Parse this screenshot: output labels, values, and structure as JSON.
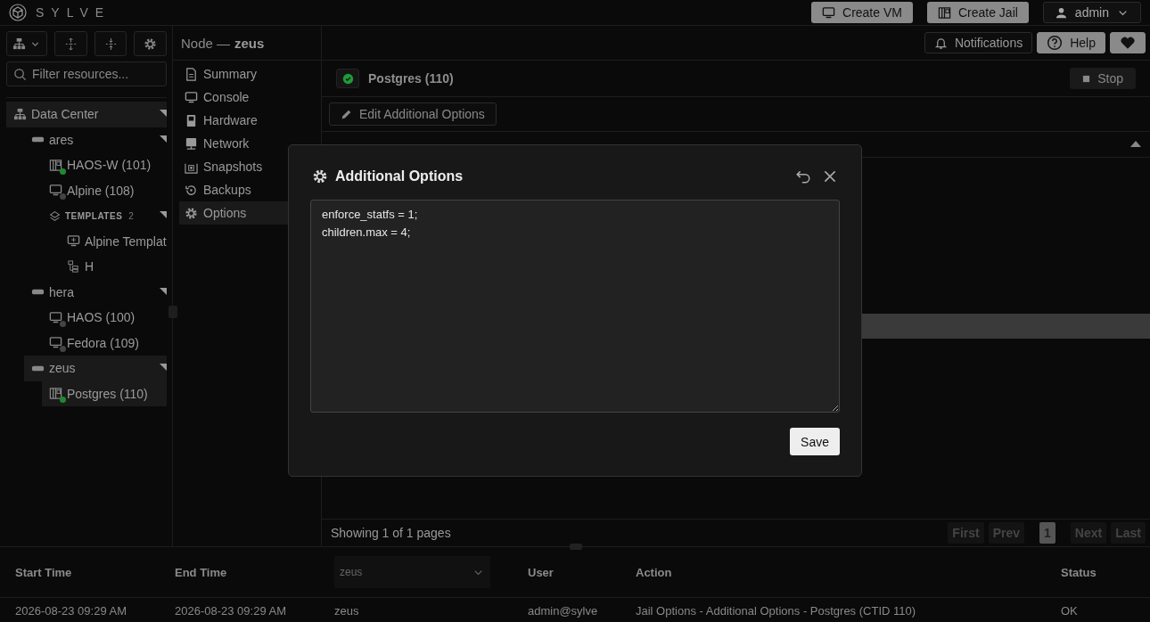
{
  "header": {
    "brand": "SYLVE",
    "buttons": [
      {
        "label": "Create VM",
        "kind": "vm"
      },
      {
        "label": "Create Jail",
        "kind": "jail"
      }
    ],
    "user": "admin"
  },
  "sidebar": {
    "filter": {
      "placeholder": "Filter resources..."
    },
    "tree": [
      {
        "label": "Data Center",
        "kind": "datacenter",
        "expanded": true,
        "children": [
          {
            "label": "ares",
            "kind": "node",
            "expanded": true,
            "children": [
              {
                "label": "HAOS-W (101)",
                "kind": "jail",
                "running": true,
                "selected": false
              },
              {
                "label": "Alpine (108)",
                "kind": "vm",
                "running": false,
                "selected": false
              },
              {
                "label": "TEMPLATES",
                "count": "2",
                "kind": "group",
                "expanded": true,
                "children": [
                  {
                    "label": "Alpine Templat",
                    "kind": "template"
                  },
                  {
                    "label": "H",
                    "kind": "jailtemplate"
                  }
                ]
              }
            ]
          },
          {
            "label": "hera",
            "kind": "node",
            "expanded": true,
            "children": [
              {
                "label": "HAOS (100)",
                "kind": "vm",
                "running": false,
                "selected": false
              },
              {
                "label": "Fedora (109)",
                "kind": "vm",
                "running": false,
                "selected": false
              }
            ]
          },
          {
            "label": "zeus",
            "kind": "node",
            "expanded": true,
            "children": [
              {
                "label": "Postgres (110)",
                "kind": "jail",
                "running": true,
                "selected": true
              }
            ]
          }
        ]
      }
    ]
  },
  "node_title": {
    "label": "Node —",
    "name": "zeus"
  },
  "top_actions": [
    {
      "label": "Notifications",
      "kind": "bell"
    },
    {
      "label": "Help",
      "kind": "help"
    },
    {
      "kind": "heart"
    }
  ],
  "nav": [
    {
      "label": "Summary",
      "kind": "file",
      "selected": false
    },
    {
      "label": "Console",
      "kind": "monitor",
      "selected": false
    },
    {
      "label": "Hardware",
      "kind": "hardware",
      "selected": false
    },
    {
      "label": "Network",
      "kind": "network",
      "selected": false
    },
    {
      "label": "Snapshots",
      "kind": "snapshot",
      "selected": false
    },
    {
      "label": "Backups",
      "kind": "backup",
      "selected": false
    },
    {
      "label": "Options",
      "kind": "gear",
      "selected": true
    }
  ],
  "panel": {
    "title": "Postgres (110)",
    "running": true,
    "stop": "Stop",
    "edit": "Edit Additional Options",
    "footer": "Showing 1 of 1 pages",
    "pager": [
      {
        "label": "First",
        "selected": false
      },
      {
        "label": "Prev",
        "selected": false
      },
      {
        "label": "1",
        "selected": true
      },
      {
        "label": "Next",
        "selected": false
      },
      {
        "label": "Last",
        "selected": false
      }
    ]
  },
  "modal": {
    "title": "Additional Options",
    "text": "enforce_statfs = 1;\nchildren.max = 4;",
    "save": "Save"
  },
  "tasks": {
    "columns": [
      {
        "kind": "text",
        "label": "Start Time"
      },
      {
        "kind": "text",
        "label": "End Time"
      },
      {
        "kind": "select",
        "label": "zeus"
      },
      {
        "kind": "text",
        "label": "User"
      },
      {
        "kind": "text",
        "label": "Action"
      },
      {
        "kind": "text",
        "label": "Status"
      }
    ],
    "rows": [
      [
        "2026-08-23 09:29 AM",
        "2026-08-23 09:29 AM",
        "zeus",
        "admin@sylve",
        "Jail Options - Additional Options - Postgres (CTID 110)",
        "OK"
      ]
    ]
  }
}
